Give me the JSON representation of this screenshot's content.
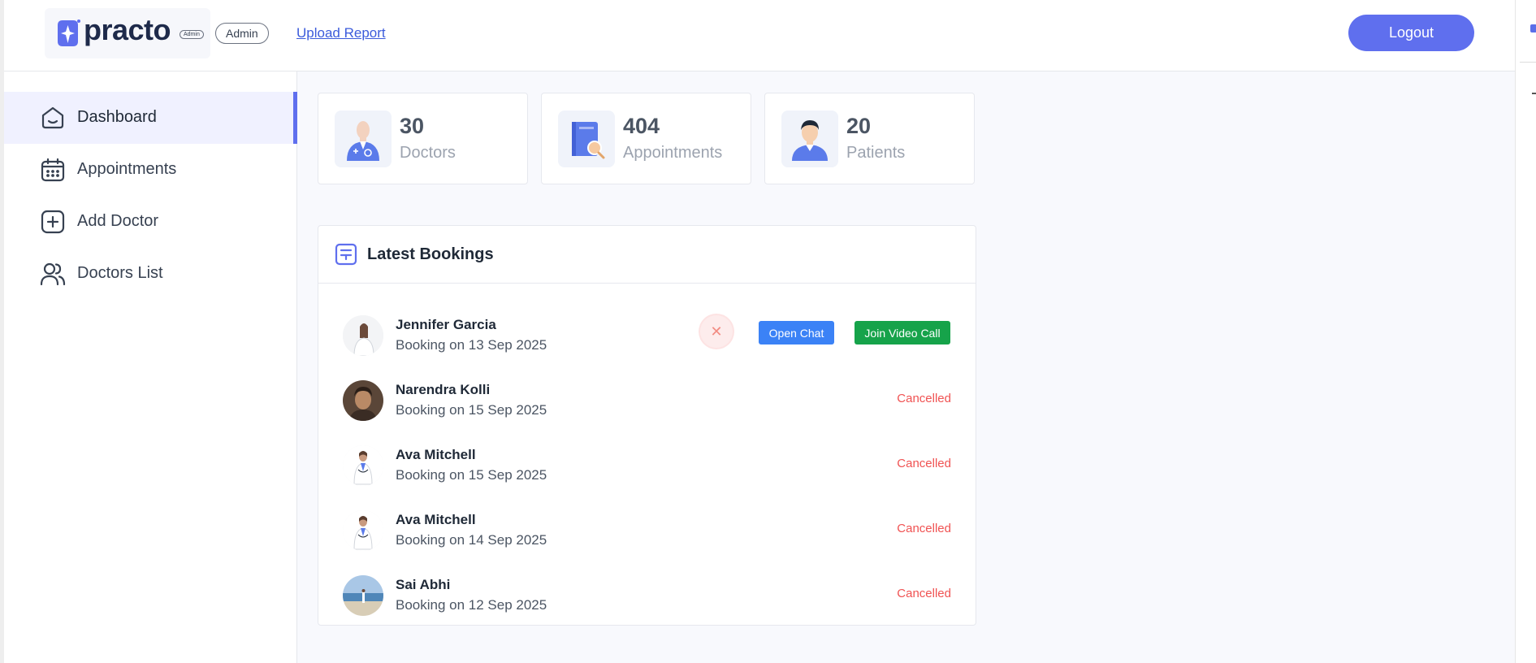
{
  "header": {
    "logo_text": "practo",
    "logo_badge": "Admin",
    "role_pill": "Admin",
    "upload_link": "Upload Report",
    "logout_label": "Logout"
  },
  "sidebar": {
    "items": [
      {
        "label": "Dashboard",
        "icon": "home-icon",
        "active": true
      },
      {
        "label": "Appointments",
        "icon": "calendar-icon",
        "active": false
      },
      {
        "label": "Add Doctor",
        "icon": "add-square-icon",
        "active": false
      },
      {
        "label": "Doctors List",
        "icon": "people-icon",
        "active": false
      }
    ]
  },
  "stats": [
    {
      "value": "30",
      "label": "Doctors",
      "icon": "doctor-icon"
    },
    {
      "value": "404",
      "label": "Appointments",
      "icon": "appointment-book-icon"
    },
    {
      "value": "20",
      "label": "Patients",
      "icon": "patient-icon"
    }
  ],
  "bookings": {
    "title": "Latest Bookings",
    "icon": "list-icon",
    "rows": [
      {
        "name": "Jennifer Garcia",
        "date": "Booking on 13 Sep 2025",
        "status": "active",
        "cancel_symbol": "✕",
        "chat_label": "Open Chat",
        "video_label": "Join Video Call"
      },
      {
        "name": "Narendra Kolli",
        "date": "Booking on 15 Sep 2025",
        "status": "Cancelled"
      },
      {
        "name": "Ava Mitchell",
        "date": "Booking on 15 Sep 2025",
        "status": "Cancelled"
      },
      {
        "name": "Ava Mitchell",
        "date": "Booking on 14 Sep 2025",
        "status": "Cancelled"
      },
      {
        "name": "Sai Abhi",
        "date": "Booking on 12 Sep 2025",
        "status": "Cancelled"
      }
    ]
  },
  "colors": {
    "accent": "#5f6fee",
    "chat": "#3b82f6",
    "video": "#16a34a",
    "cancelled": "#f05252"
  }
}
